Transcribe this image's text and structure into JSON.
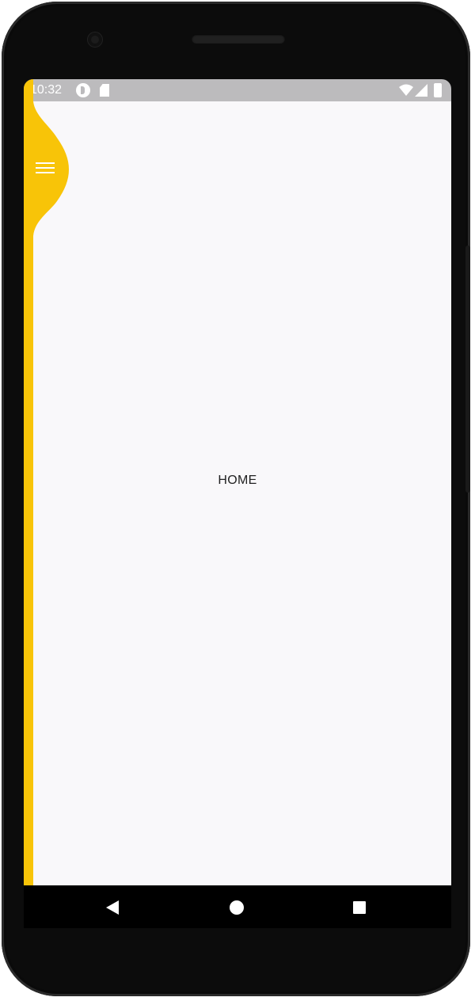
{
  "status_bar": {
    "time": "10:32",
    "icons": [
      "pocket-casts-icon",
      "sd-card-icon",
      "wifi-icon",
      "signal-icon",
      "battery-icon"
    ]
  },
  "app": {
    "menu_icon": "hamburger-menu-icon",
    "accent_color": "#f8c408",
    "background_color": "#f9f8fa",
    "center_label": "HOME"
  },
  "nav_bar": {
    "buttons": [
      "back-icon",
      "home-icon",
      "recents-icon"
    ]
  }
}
